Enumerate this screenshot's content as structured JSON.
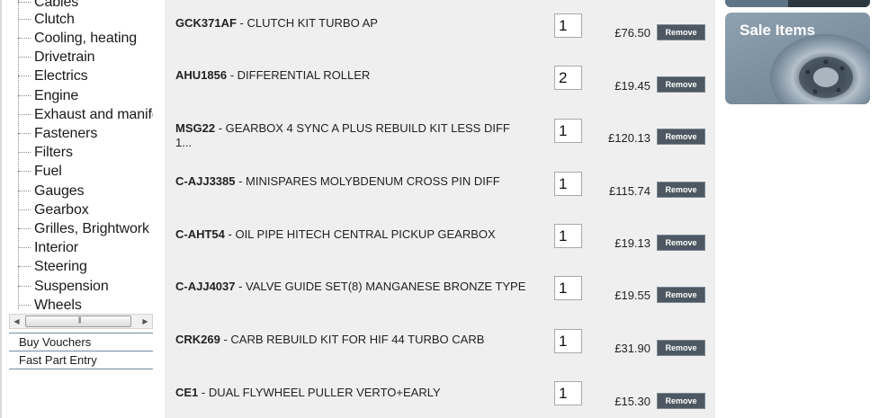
{
  "sidebar": {
    "categories": [
      "Cables",
      "Clutch",
      "Cooling, heating",
      "Drivetrain",
      "Electrics",
      "Engine",
      "Exhaust and manifo",
      "Fasteners",
      "Filters",
      "Fuel",
      "Gauges",
      "Gearbox",
      "Grilles, Brightwork",
      "Interior",
      "Steering",
      "Suspension",
      "Wheels"
    ],
    "links": [
      "Buy Vouchers",
      "Fast Part Entry"
    ]
  },
  "basket": {
    "remove_label": "Remove",
    "items": [
      {
        "code": "GCK371AF",
        "desc": " - CLUTCH KIT TURBO AP",
        "qty": "1",
        "price": "£76.50"
      },
      {
        "code": "AHU1856",
        "desc": " - DIFFERENTIAL ROLLER",
        "qty": "2",
        "price": "£19.45"
      },
      {
        "code": "MSG22",
        "desc": " - GEARBOX 4 SYNC A PLUS REBUILD KIT LESS DIFF 1...",
        "qty": "1",
        "price": "£120.13"
      },
      {
        "code": "C-AJJ3385",
        "desc": " - MINISPARES MOLYBDENUM CROSS PIN DIFF",
        "qty": "1",
        "price": "£115.74"
      },
      {
        "code": "C-AHT54",
        "desc": " - OIL PIPE HITECH CENTRAL PICKUP GEARBOX",
        "qty": "1",
        "price": "£19.13"
      },
      {
        "code": "C-AJJ4037",
        "desc": " - VALVE GUIDE SET(8) MANGANESE BRONZE TYPE",
        "qty": "1",
        "price": "£19.55"
      },
      {
        "code": "CRK269",
        "desc": " - CARB REBUILD KIT FOR HIF 44 TURBO CARB",
        "qty": "1",
        "price": "£31.90"
      },
      {
        "code": "CE1",
        "desc": " - DUAL FLYWHEEL PULLER VERTO+EARLY",
        "qty": "1",
        "price": "£15.30"
      }
    ]
  },
  "promos": {
    "sale_title": "Sale Items"
  }
}
